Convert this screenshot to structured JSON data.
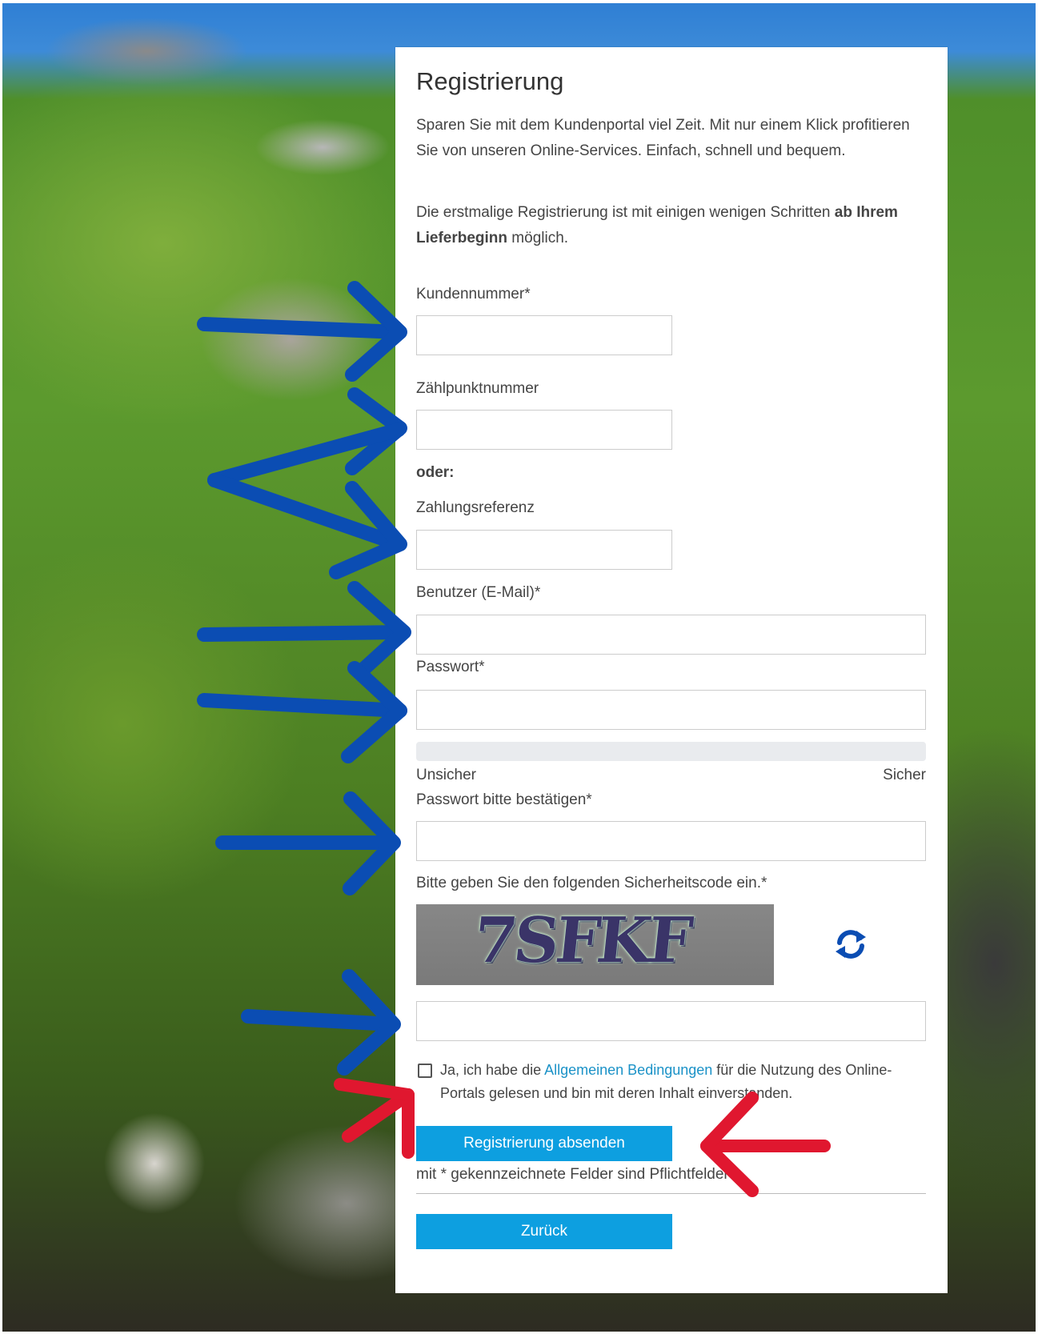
{
  "title": "Registrierung",
  "intro": "Sparen Sie mit dem Kundenportal viel Zeit. Mit nur einem Klick profitieren Sie von unseren Online-Services. Einfach, schnell und bequem.",
  "info": {
    "before": "Die erstmalige Registrierung ist mit einigen wenigen Schritten ",
    "bold": "ab Ihrem Lieferbeginn",
    "after": " möglich."
  },
  "fields": {
    "kundennummer_label": "Kundennummer*",
    "zaehlpunkt_label": "Zählpunktnummer",
    "oder": "oder:",
    "zahlungsreferenz_label": "Zahlungsreferenz",
    "email_label": "Benutzer (E-Mail)*",
    "password_label": "Passwort*",
    "strength_low": "Unsicher",
    "strength_high": "Sicher",
    "confirm_label": "Passwort bitte bestätigen*",
    "captcha_label": "Bitte geben Sie den folgenden Sicherheitscode ein.*",
    "captcha_text": "7SFKF"
  },
  "terms": {
    "before": "Ja, ich habe die ",
    "link": "Allgemeinen Bedingungen",
    "after": " für die Nutzung des Online-Portals gelesen und bin mit deren Inhalt einverstanden."
  },
  "buttons": {
    "submit": "Registrierung absenden",
    "back": "Zurück"
  },
  "required_note": "mit * gekennzeichnete Felder sind Pflichtfelder",
  "icons": {
    "refresh": "refresh-icon"
  },
  "colors": {
    "button": "#0d9fe0",
    "link": "#1b92c7",
    "arrow_blue": "#0b4db3",
    "arrow_red": "#e0172f"
  }
}
